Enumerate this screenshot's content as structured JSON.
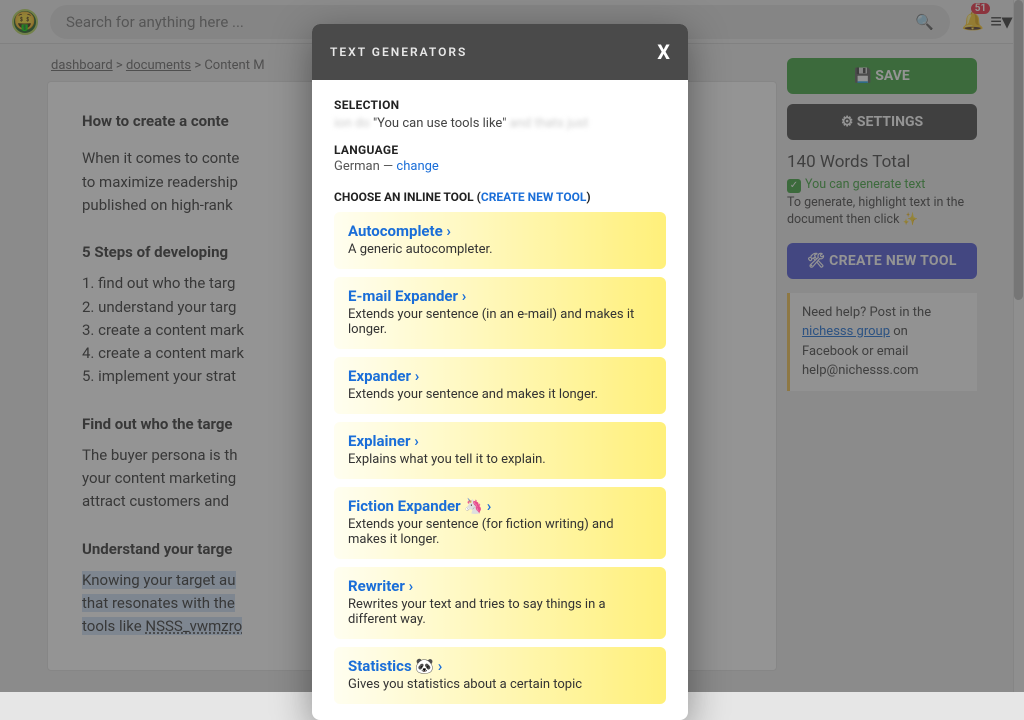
{
  "topbar": {
    "search_placeholder": "Search for anything here ...",
    "notification_count": "51"
  },
  "breadcrumbs": {
    "dashboard": "dashboard",
    "documents": "documents",
    "current": "Content M"
  },
  "document": {
    "title_visible": "How to create a conte",
    "intro_line1": "When it comes to conte",
    "intro_line2": "to maximize readership",
    "intro_line3": "published on high-rank",
    "steps_heading": "5 Steps of developing",
    "step1": "1. find out who the targ",
    "step2": "2. understand your targ",
    "step3": "3. create a content mark",
    "step4": "4. create a content mark",
    "step5": "5. implement your strat",
    "sec1_heading": "Find out who the targe",
    "sec1_l1": "The buyer persona is th",
    "sec1_l2": "your content marketing",
    "sec1_l3": "attract customers and",
    "sec2_heading": "Understand your targe",
    "sec2_l1": "Knowing your target au",
    "sec2_l2": "that resonates with the",
    "sec2_l3a": "tools like ",
    "sec2_link": "NSSS_vwmzro"
  },
  "sidebar": {
    "save_label": "💾 SAVE",
    "settings_label": "⚙ SETTINGS",
    "word_count": "140 Words Total",
    "gen_ok": "You can generate text",
    "gen_hint": "To generate, highlight text in the document then click ✨",
    "new_tool_label": "🛠 CREATE NEW TOOL",
    "help_pre": "Need help? Post in the ",
    "help_link": "nichesss group",
    "help_post": " on Facebook or email help@nichesss.com"
  },
  "modal": {
    "title": "TEXT GENERATORS",
    "selection_label": "SELECTION",
    "selection_prefix_blur": "ion do ",
    "selection_quote": "\"You can use tools like\"",
    "selection_suffix_blur": " and thats just",
    "language_label": "LANGUAGE",
    "language_value": "German — ",
    "language_change": "change",
    "choose_label": "CHOOSE AN INLINE TOOL   (",
    "create_new": "CREATE NEW TOOL",
    "choose_label_close": ")",
    "tools": [
      {
        "name": "Autocomplete  ›",
        "desc": "A generic autocompleter."
      },
      {
        "name": "E-mail Expander  ›",
        "desc": "Extends your sentence (in an e-mail) and makes it longer."
      },
      {
        "name": "Expander  ›",
        "desc": "Extends your sentence and makes it longer."
      },
      {
        "name": "Explainer  ›",
        "desc": "Explains what you tell it to explain."
      },
      {
        "name": "Fiction Expander 🦄  ›",
        "desc": "Extends your sentence (for fiction writing) and makes it longer."
      },
      {
        "name": "Rewriter  ›",
        "desc": "Rewrites your text and tries to say things in a different way."
      },
      {
        "name": "Statistics 🐼  ›",
        "desc": "Gives you statistics about a certain topic"
      }
    ]
  }
}
